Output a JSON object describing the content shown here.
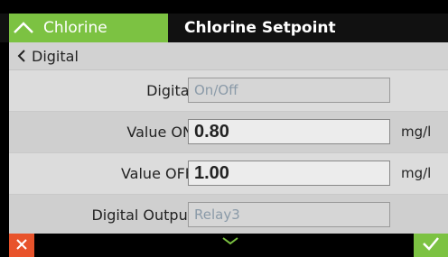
{
  "header": {
    "tab_label": "Chlorine",
    "title": "Chlorine Setpoint",
    "accent_color": "#7cc242"
  },
  "breadcrumb": {
    "label": "Digital"
  },
  "rows": [
    {
      "label": "Digital",
      "value": "On/Off",
      "unit": ""
    },
    {
      "label": "Value ON",
      "value": "0.80",
      "unit": "mg/l"
    },
    {
      "label": "Value OFF",
      "value": "1.00",
      "unit": "mg/l"
    },
    {
      "label": "Digital Output",
      "value": "Relay3",
      "unit": ""
    }
  ],
  "footer": {
    "cancel_icon": "close-icon",
    "ok_icon": "checkmark-icon",
    "scroll_icon": "chevron-down-icon",
    "cancel_color": "#e8532b",
    "ok_color": "#7cc242"
  }
}
